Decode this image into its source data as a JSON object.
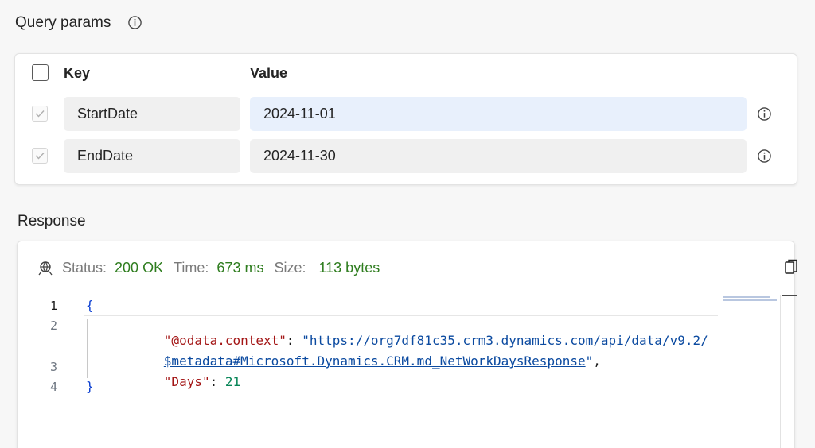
{
  "query_params": {
    "title": "Query params",
    "header_key": "Key",
    "header_value": "Value",
    "rows": [
      {
        "key": "StartDate",
        "value": "2024-11-01"
      },
      {
        "key": "EndDate",
        "value": "2024-11-30"
      }
    ]
  },
  "response": {
    "title": "Response",
    "status_label": "Status:",
    "status_value": "200 OK",
    "time_label": "Time:",
    "time_value": "673 ms",
    "size_label": "Size:",
    "size_value": "113 bytes",
    "line_numbers": [
      "1",
      "2",
      "3",
      "4"
    ],
    "code": {
      "open_brace": "{",
      "context_key": "\"@odata.context\"",
      "context_value_line1": "\"https://org7df81c35.crm3.dynamics.com/api/data/v9.2/",
      "context_value_line2": "$metadata#Microsoft.Dynamics.CRM.md_NetWorkDaysResponse",
      "context_value_end": "\"",
      "days_key": "\"Days\"",
      "days_value": "21",
      "close_brace": "}"
    }
  },
  "colors": {
    "status_ok": "#2f7d1f",
    "json_key": "#a31515",
    "json_string": "#0b4aa0",
    "json_number": "#098658",
    "focused_field": "#e8f0fc"
  },
  "icons": [
    "info-icon",
    "checkmark-icon",
    "network-icon",
    "copy-icon"
  ]
}
